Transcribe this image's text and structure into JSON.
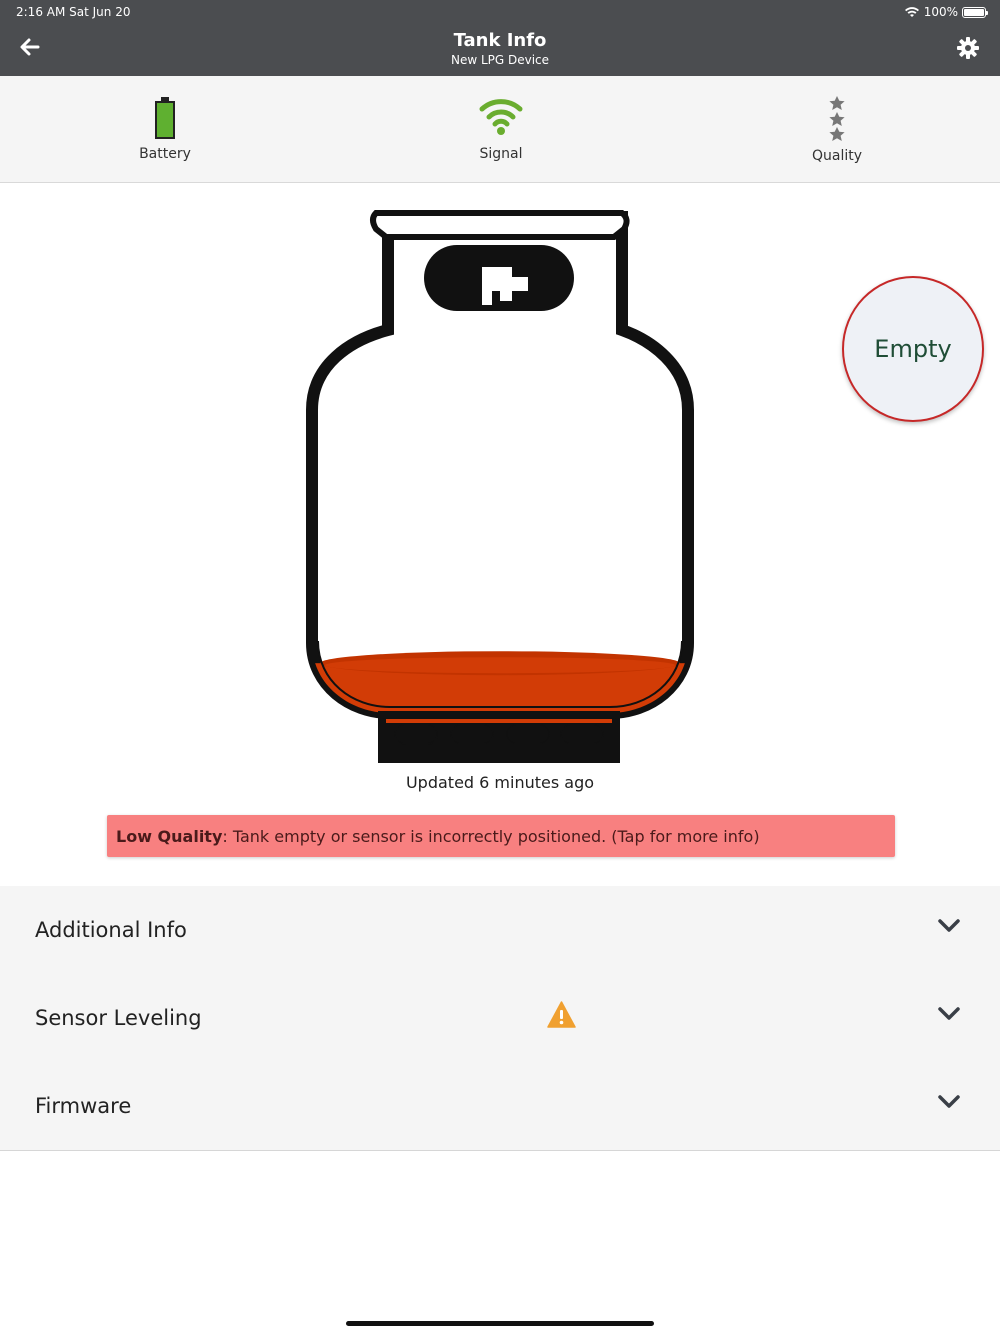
{
  "status_bar": {
    "time": "2:16 AM   Sat Jun 20",
    "battery_percent": "100%",
    "icons": [
      "wifi-icon",
      "battery-icon"
    ]
  },
  "header": {
    "title": "Tank Info",
    "subtitle": "New LPG Device",
    "icons": [
      "back-arrow-icon",
      "gear-icon"
    ]
  },
  "metrics": {
    "battery": {
      "label": "Battery",
      "icon": "battery-icon",
      "color": "#5fb030"
    },
    "signal": {
      "label": "Signal",
      "icon": "wifi-signal-icon",
      "color": "#6aad2f"
    },
    "quality": {
      "label": "Quality",
      "icon": "stars-icon",
      "stars_filled": 0,
      "stars_total": 3
    }
  },
  "tank": {
    "fill_level_fraction": 0.05,
    "liquid_color": "#d23c06",
    "status_label": "Empty",
    "status_border_color": "#c62828"
  },
  "updated_text": "Updated 6 minutes ago",
  "alert": {
    "bold": "Low Quality",
    "message": ": Tank empty or sensor is incorrectly positioned. (Tap for more info)",
    "background": "#f88080"
  },
  "sections": [
    {
      "label": "Additional Info",
      "warning": false
    },
    {
      "label": "Sensor Leveling",
      "warning": true,
      "warning_color": "#f0a030"
    },
    {
      "label": "Firmware",
      "warning": false
    }
  ]
}
